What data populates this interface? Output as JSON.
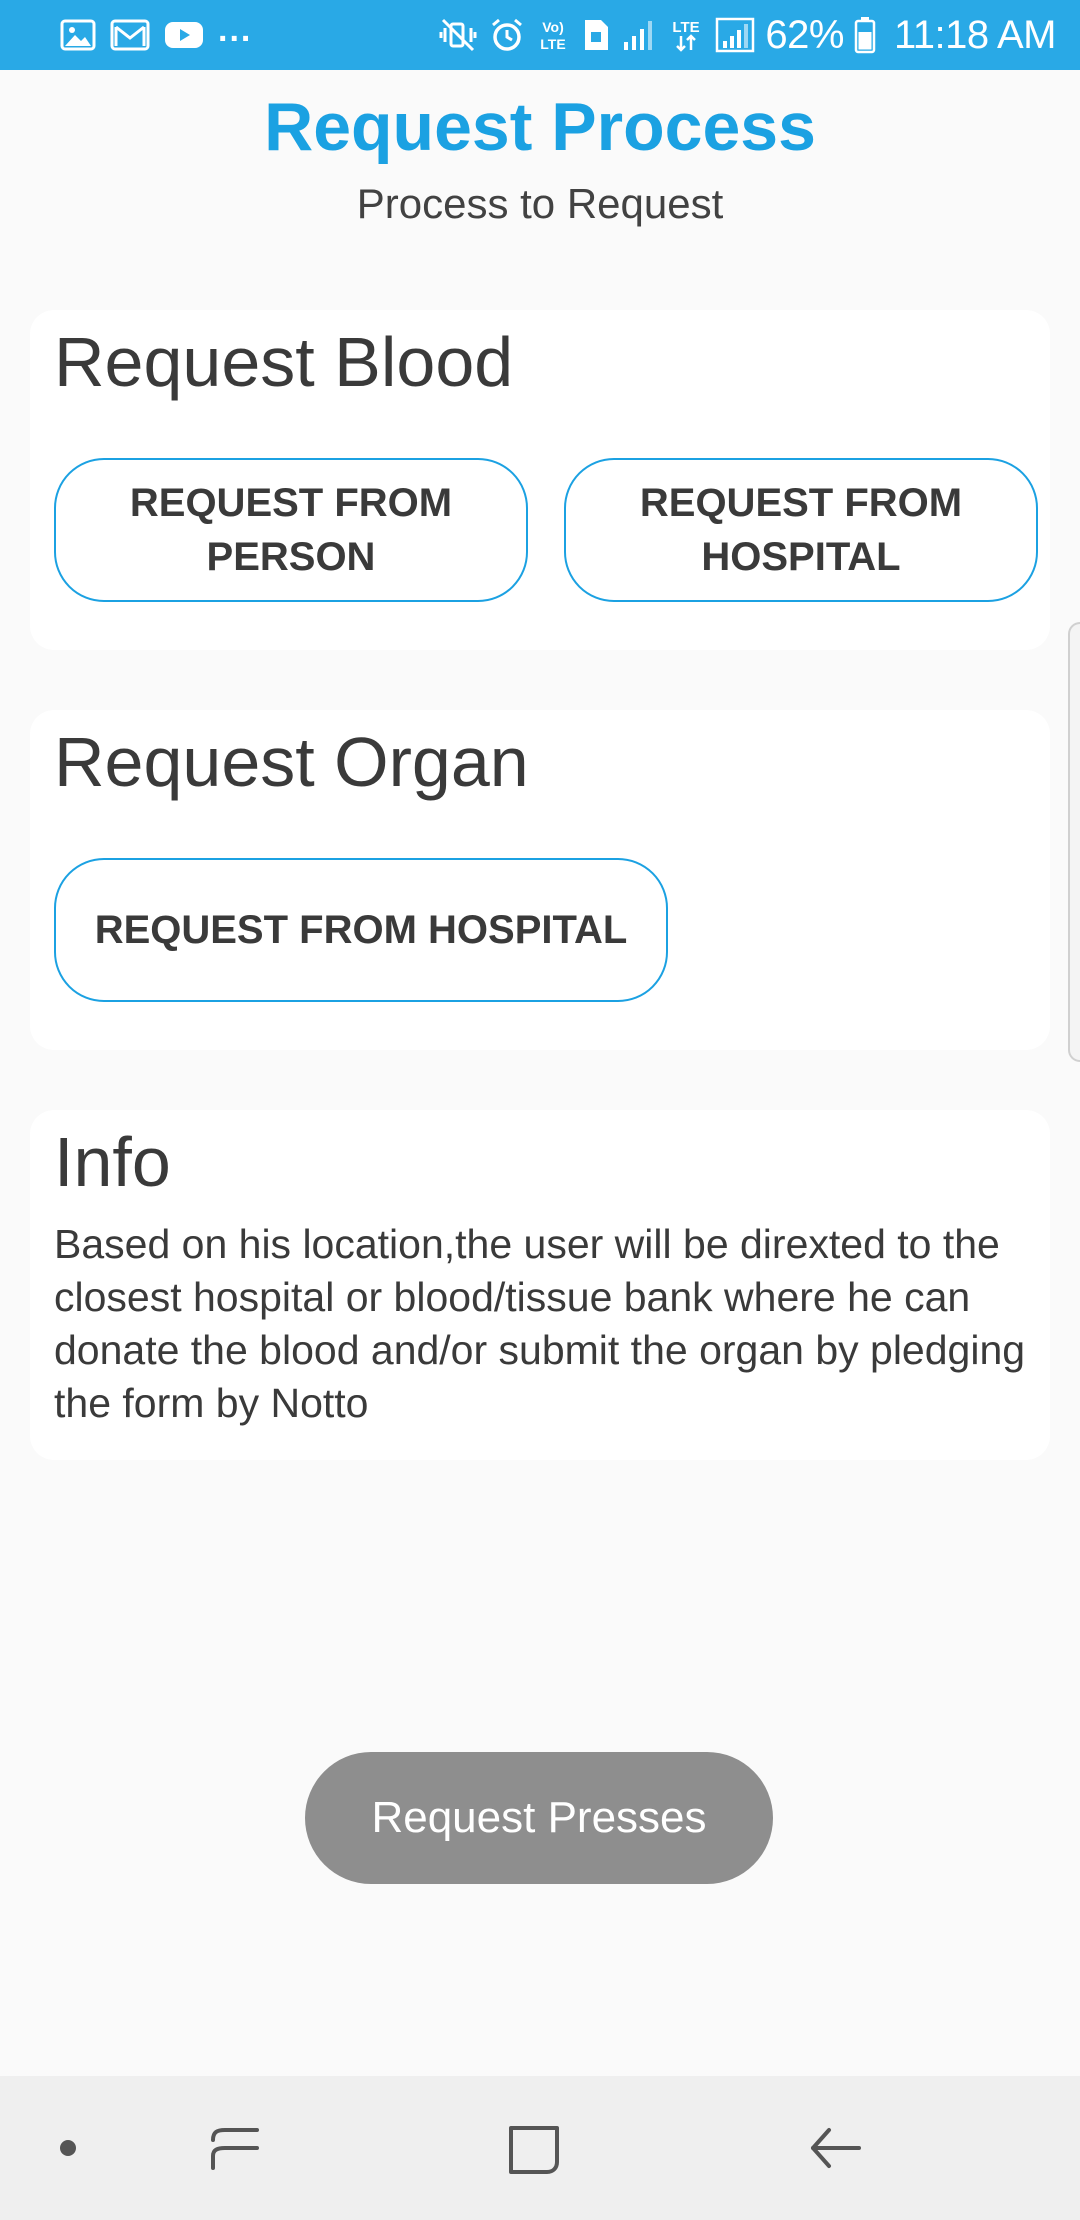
{
  "status_bar": {
    "battery_percent": "62%",
    "time": "11:18 AM",
    "left_icons": [
      "gallery-icon",
      "gmail-icon",
      "youtube-icon"
    ],
    "overflow": "...",
    "right_icons": [
      "mute-icon",
      "alarm-icon",
      "volte-icon",
      "sim-icon",
      "signal-icon",
      "lte-icon",
      "signal-icon",
      "battery-icon"
    ],
    "color": "#29a9e6"
  },
  "header": {
    "title": "Request Process",
    "subtitle": "Process to Request",
    "title_color": "#1ba1e2"
  },
  "blood": {
    "title": "Request Blood",
    "btn_person_line1": "REQUEST FROM",
    "btn_person_line2": "PERSON",
    "btn_hospital_line1": "REQUEST FROM",
    "btn_hospital_line2": "HOSPITAL"
  },
  "organ": {
    "title": "Request Organ",
    "btn_hospital": "REQUEST FROM HOSPITAL"
  },
  "info": {
    "title": "Info",
    "text": "Based on his location,the user will be direxted to the closest hospital or blood/tissue bank where he can donate the blood and/or submit the organ by pledging the form by Notto"
  },
  "primary_button": {
    "label": "Request Presses",
    "color": "#8e8e8e"
  },
  "nav": {
    "items": [
      "dot-icon",
      "recents-icon",
      "home-icon",
      "back-icon"
    ]
  }
}
